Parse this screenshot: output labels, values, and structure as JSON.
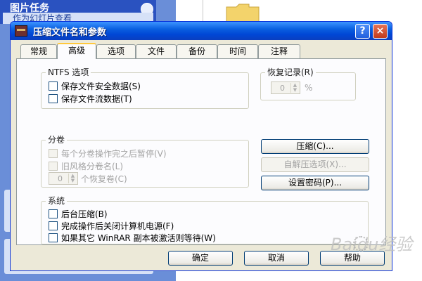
{
  "background": {
    "task_pane_title": "图片任务",
    "task_pane_item": "作为幻灯片查看"
  },
  "dialog": {
    "title": "压缩文件名和参数",
    "help_glyph": "?",
    "close_glyph": "×",
    "tabs": [
      "常规",
      "高级",
      "选项",
      "文件",
      "备份",
      "时间",
      "注释"
    ],
    "active_tab": "高级",
    "ntfs": {
      "title": "NTFS 选项",
      "items": [
        "保存文件安全数据(S)",
        "保存文件流数据(T)"
      ]
    },
    "recovery": {
      "title": "恢复记录(R)",
      "value": "0",
      "unit": "%"
    },
    "volumes": {
      "title": "分卷",
      "items": [
        "每个分卷操作完之后暂停(V)",
        "旧风格分卷名(L)"
      ],
      "spinner_value": "0",
      "spinner_label": "个恢复卷(C)"
    },
    "buttons": {
      "compression": "压缩(C)...",
      "sfx_options": "自解压选项(X)...",
      "set_password": "设置密码(P)..."
    },
    "system": {
      "title": "系统",
      "items": [
        "后台压缩(B)",
        "完成操作后关闭计算机电源(F)",
        "如果其它 WinRAR 副本被激活则等待(W)"
      ]
    },
    "footer": {
      "ok": "确定",
      "cancel": "取消",
      "help": "帮助"
    }
  },
  "watermark": "Baidu经验",
  "colors": {
    "title_bar": "#0046d5",
    "dialog_face": "#ece9d8",
    "active_tab_accent": "#ffc83c",
    "close_button": "#c23a1c"
  }
}
